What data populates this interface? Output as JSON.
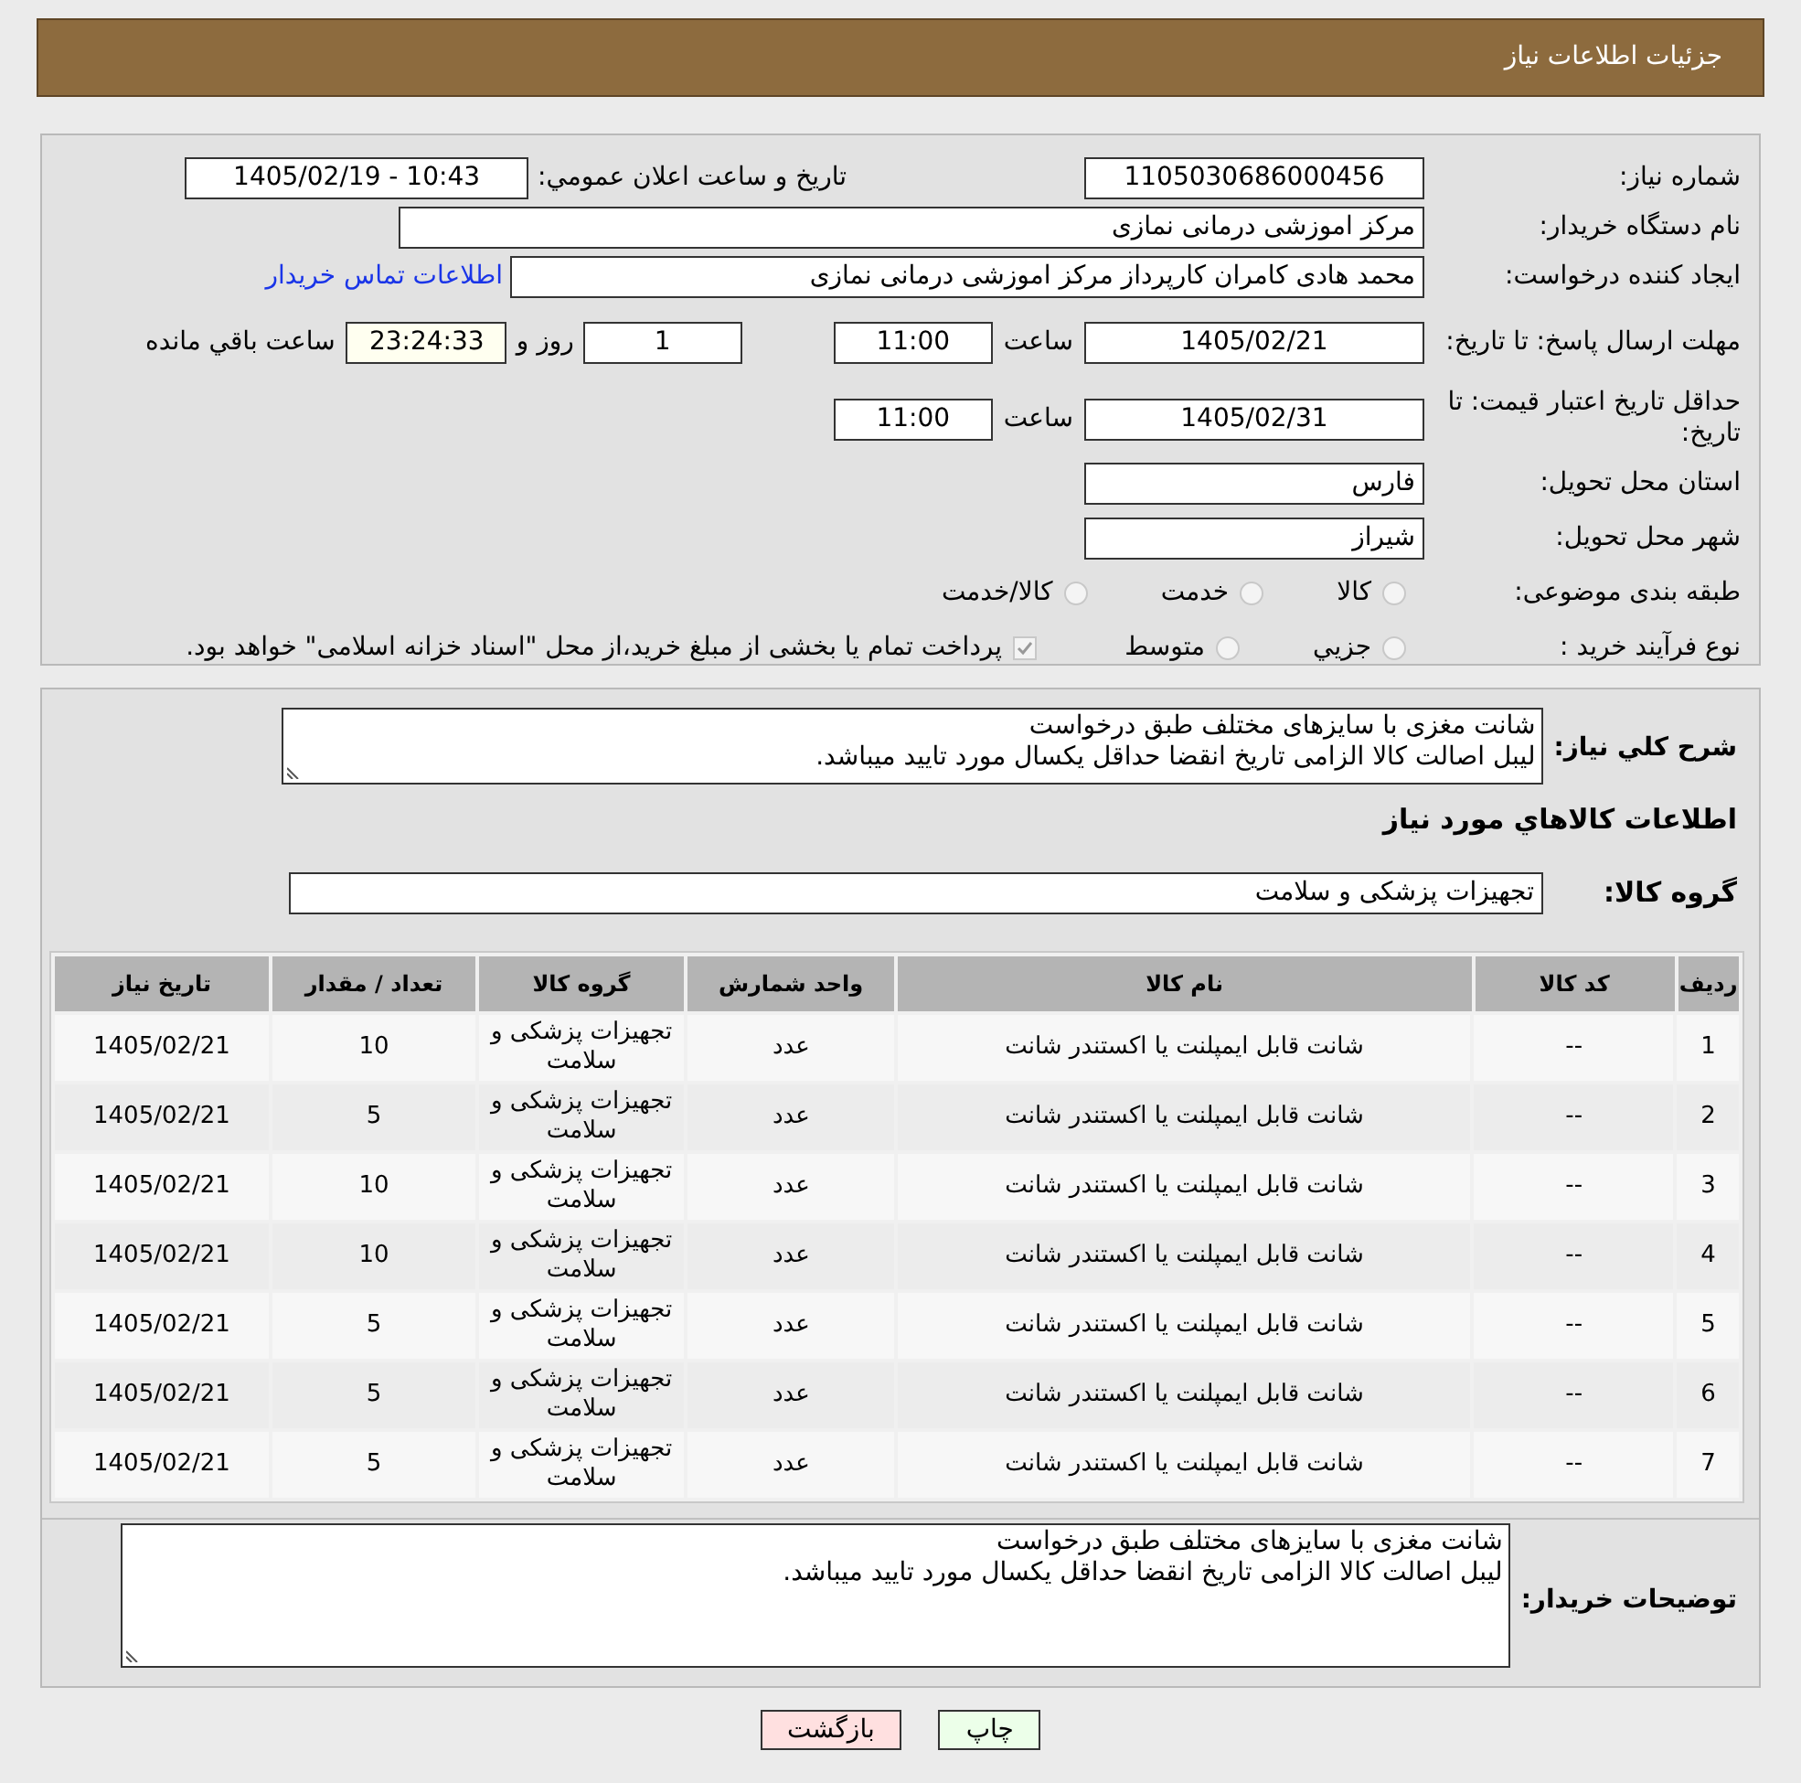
{
  "header": {
    "title": "جزئیات اطلاعات نیاز"
  },
  "info": {
    "need_number_label": "شماره نیاز:",
    "need_number": "1105030686000456",
    "announce_label": "تاریخ و ساعت اعلان عمومي:",
    "announce_value": "1405/02/19 - 10:43",
    "buyer_label": "نام دستگاه خریدار:",
    "buyer": "مرکز اموزشی درمانی نمازی",
    "creator_label": "ایجاد کننده درخواست:",
    "creator": "محمد هادی کامران کارپرداز مرکز اموزشی درمانی نمازی",
    "contact_link": "اطلاعات تماس خریدار",
    "deadline_label": "مهلت ارسال پاسخ: تا تاریخ:",
    "deadline_date": "1405/02/21",
    "deadline_time_label": "ساعت",
    "deadline_time": "11:00",
    "days": "1",
    "days_label": "روز و",
    "remaining": "23:24:33",
    "remaining_label": "ساعت باقي مانده",
    "validity_label": "حداقل تاریخ اعتبار قیمت: تا تاریخ:",
    "validity_date": "1405/02/31",
    "validity_time_label": "ساعت",
    "validity_time": "11:00",
    "province_label": "استان محل تحویل:",
    "province": "فارس",
    "city_label": "شهر محل تحویل:",
    "city": "شیراز",
    "category_label": "طبقه بندی موضوعی:",
    "categories": [
      {
        "label": "کالا",
        "selected": false
      },
      {
        "label": "خدمت",
        "selected": false
      },
      {
        "label": "کالا/خدمت",
        "selected": false
      }
    ],
    "process_label": "نوع فرآیند خرید :",
    "processes": [
      {
        "label": "جزيي",
        "selected": false
      },
      {
        "label": "متوسط",
        "selected": false
      }
    ],
    "treasury": {
      "label": "پرداخت تمام یا بخشی از مبلغ خرید،از محل \"اسناد خزانه اسلامی\" خواهد بود.",
      "checked": true
    }
  },
  "details": {
    "description_label": "شرح کلي نیاز:",
    "description": [
      "شانت مغزی با سایزهای مختلف طبق درخواست",
      "لیبل اصالت کالا الزامی تاریخ انقضا حداقل یکسال مورد تایید میباشد."
    ],
    "goods_title": "اطلاعات کالاهاي مورد نیاز",
    "group_label": "گروه کالا:",
    "group": "تجهیزات پزشکی و سلامت",
    "table": {
      "columns": [
        "ردیف",
        "کد کالا",
        "نام کالا",
        "واحد شمارش",
        "گروه کالا",
        "تعداد / مقدار",
        "تاریخ نیاز"
      ],
      "rows": [
        [
          "1",
          "--",
          "شانت قابل ایمپلنت یا اکستندر شانت",
          "عدد",
          "تجهیزات پزشکی و سلامت",
          "10",
          "1405/02/21"
        ],
        [
          "2",
          "--",
          "شانت قابل ایمپلنت یا اکستندر شانت",
          "عدد",
          "تجهیزات پزشکی و سلامت",
          "5",
          "1405/02/21"
        ],
        [
          "3",
          "--",
          "شانت قابل ایمپلنت یا اکستندر شانت",
          "عدد",
          "تجهیزات پزشکی و سلامت",
          "10",
          "1405/02/21"
        ],
        [
          "4",
          "--",
          "شانت قابل ایمپلنت یا اکستندر شانت",
          "عدد",
          "تجهیزات پزشکی و سلامت",
          "10",
          "1405/02/21"
        ],
        [
          "5",
          "--",
          "شانت قابل ایمپلنت یا اکستندر شانت",
          "عدد",
          "تجهیزات پزشکی و سلامت",
          "5",
          "1405/02/21"
        ],
        [
          "6",
          "--",
          "شانت قابل ایمپلنت یا اکستندر شانت",
          "عدد",
          "تجهیزات پزشکی و سلامت",
          "5",
          "1405/02/21"
        ],
        [
          "7",
          "--",
          "شانت قابل ایمپلنت یا اکستندر شانت",
          "عدد",
          "تجهیزات پزشکی و سلامت",
          "5",
          "1405/02/21"
        ]
      ]
    },
    "buyer_notes_label": "توضیحات خریدار:",
    "buyer_notes": [
      "شانت مغزی با سایزهای مختلف طبق درخواست",
      "لیبل اصالت کالا الزامی تاریخ انقضا حداقل یکسال مورد تایید میباشد."
    ]
  },
  "buttons": [
    {
      "label": "چاپ",
      "kind": "print"
    },
    {
      "label": "بازگشت",
      "kind": "back"
    }
  ]
}
